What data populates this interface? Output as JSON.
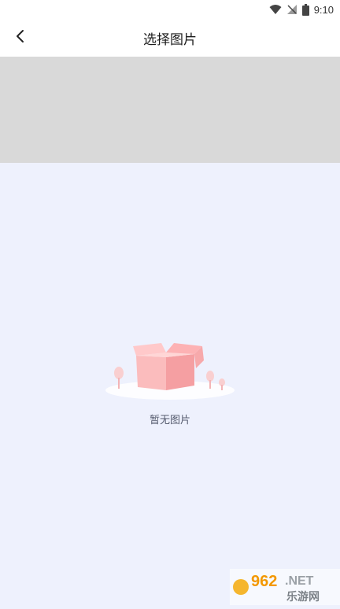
{
  "status_bar": {
    "time": "9:10"
  },
  "header": {
    "title": "选择图片"
  },
  "empty_state": {
    "text": "暂无图片"
  },
  "watermark": {
    "brand_number": "962",
    "brand_suffix": ".NET",
    "brand_name": "乐游网"
  }
}
